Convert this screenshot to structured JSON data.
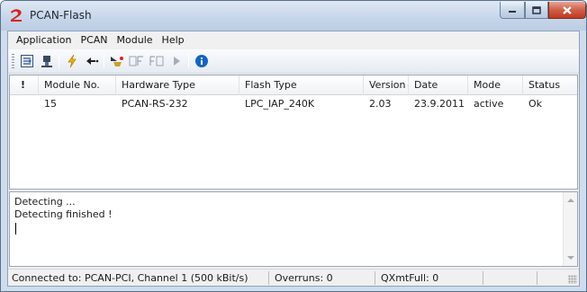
{
  "window": {
    "title": "PCAN-Flash"
  },
  "icons": {
    "app": "pcan-logo-icon",
    "minimize": "minimize-icon",
    "maximize": "maximize-icon",
    "close": "close-icon"
  },
  "menu": {
    "items": [
      "Application",
      "PCAN",
      "Module",
      "Help"
    ]
  },
  "toolbar": {
    "buttons": [
      "settings-icon",
      "connect-icon",
      "detect-icon",
      "back-icon",
      "program-icon",
      "fill-flash-icon",
      "flash-icon",
      "run-icon",
      "info-icon"
    ]
  },
  "grid": {
    "columns": [
      "!",
      "Module No.",
      "Hardware Type",
      "Flash Type",
      "Version",
      "Date",
      "Mode",
      "Status"
    ],
    "rows": [
      {
        "flag": "",
        "module_no": "15",
        "hardware_type": "PCAN-RS-232",
        "flash_type": "LPC_IAP_240K",
        "version": "2.03",
        "date": "23.9.2011",
        "mode": "active",
        "status": "Ok"
      }
    ]
  },
  "log": {
    "lines": [
      "Detecting ...",
      "Detecting finished !"
    ]
  },
  "status": {
    "connection": "Connected to: PCAN-PCI, Channel 1 (500 kBit/s)",
    "overruns": "Overruns: 0",
    "qxmtfull": "QXmtFull: 0"
  },
  "colors": {
    "accent_red": "#d8231f",
    "info_blue": "#1565c0",
    "flash_yellow": "#f4b400"
  }
}
